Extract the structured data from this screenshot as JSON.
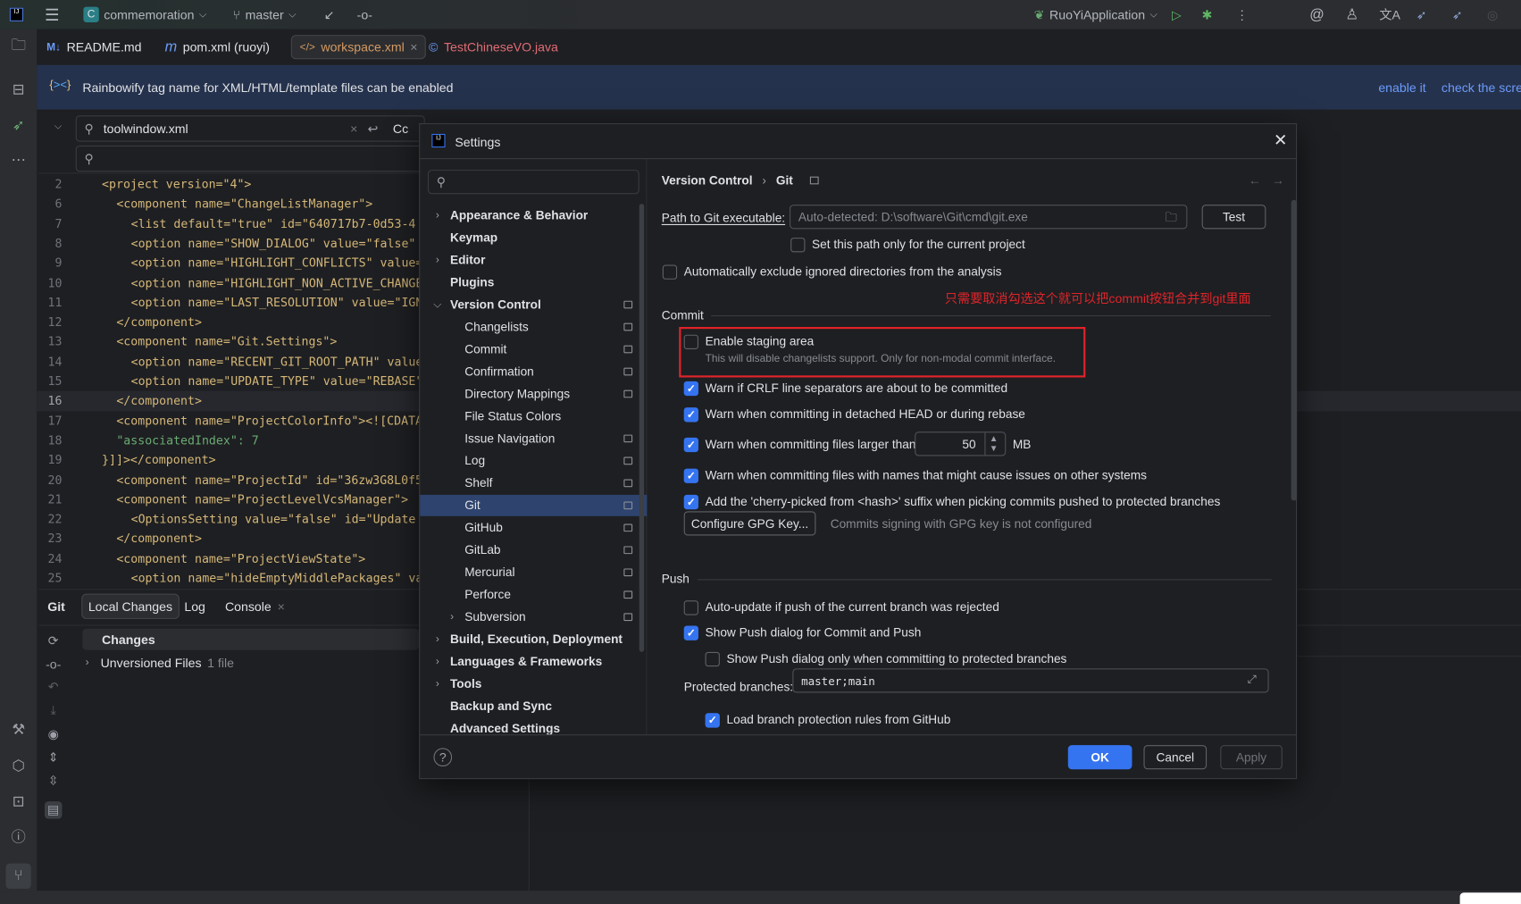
{
  "topbar": {
    "project_badge": "C",
    "project": "commemoration",
    "branch": "master",
    "run_config": "RuoYiApplication"
  },
  "tabs": [
    {
      "icon": "M↓",
      "label": "README.md",
      "color": "#dfe1e5"
    },
    {
      "icon": "m",
      "label": "pom.xml (ruoyi)",
      "color": "#dfe1e5"
    },
    {
      "icon": "</>",
      "label": "workspace.xml",
      "active": true,
      "color": "#d59a63"
    },
    {
      "icon": "©",
      "label": "TestChineseVO.java",
      "color": "#e06c75"
    }
  ],
  "banner": {
    "text": "Rainbowify tag name for XML/HTML/template files can be enabled",
    "enable_link": "enable it",
    "screenshot_link": "check the scree"
  },
  "editor_search": {
    "query": "toolwindow.xml",
    "case_label": "Cc"
  },
  "code": {
    "current_line": 16,
    "lines": [
      {
        "n": 2,
        "indent": 0,
        "text": "<project version=\"4\">"
      },
      {
        "n": 6,
        "indent": 1,
        "text": "<component name=\"ChangeListManager\">"
      },
      {
        "n": 7,
        "indent": 2,
        "text": "<list default=\"true\" id=\"640717b7-0d53-4"
      },
      {
        "n": 8,
        "indent": 2,
        "text": "<option name=\"SHOW_DIALOG\" value=\"false\""
      },
      {
        "n": 9,
        "indent": 2,
        "text": "<option name=\"HIGHLIGHT_CONFLICTS\" value="
      },
      {
        "n": 10,
        "indent": 2,
        "text": "<option name=\"HIGHLIGHT_NON_ACTIVE_CHANGE"
      },
      {
        "n": 11,
        "indent": 2,
        "text": "<option name=\"LAST_RESOLUTION\" value=\"IGN"
      },
      {
        "n": 12,
        "indent": 1,
        "text": "</component>"
      },
      {
        "n": 13,
        "indent": 1,
        "text": "<component name=\"Git.Settings\">"
      },
      {
        "n": 14,
        "indent": 2,
        "text": "<option name=\"RECENT_GIT_ROOT_PATH\" value"
      },
      {
        "n": 15,
        "indent": 2,
        "text": "<option name=\"UPDATE_TYPE\" value=\"REBASE\""
      },
      {
        "n": 16,
        "indent": 1,
        "text": "</component>"
      },
      {
        "n": 17,
        "indent": 1,
        "text": "<component name=\"ProjectColorInfo\"><![CDATA[{"
      },
      {
        "n": 18,
        "indent": 1,
        "text": "\"associatedIndex\": 7"
      },
      {
        "n": 19,
        "indent": 0,
        "text": "}]]></component>"
      },
      {
        "n": 20,
        "indent": 1,
        "text": "<component name=\"ProjectId\" id=\"36zw3G8L0f5"
      },
      {
        "n": 21,
        "indent": 1,
        "text": "<component name=\"ProjectLevelVcsManager\">"
      },
      {
        "n": 22,
        "indent": 2,
        "text": "<OptionsSetting value=\"false\" id=\"Update"
      },
      {
        "n": 23,
        "indent": 1,
        "text": "</component>"
      },
      {
        "n": 24,
        "indent": 1,
        "text": "<component name=\"ProjectViewState\">"
      },
      {
        "n": 25,
        "indent": 2,
        "text": "<option name=\"hideEmptyMiddlePackages\" va"
      }
    ]
  },
  "git_window": {
    "title": "Git",
    "tabs": [
      "Local Changes",
      "Log",
      "Console"
    ],
    "changes_label": "Changes",
    "unversioned_label": "Unversioned Files",
    "unversioned_count": "1 file"
  },
  "settings": {
    "title": "Settings",
    "search_placeholder": "",
    "tree": [
      {
        "label": "Appearance & Behavior",
        "level": 0,
        "bold": true,
        "expandable": true
      },
      {
        "label": "Keymap",
        "level": 0,
        "bold": true
      },
      {
        "label": "Editor",
        "level": 0,
        "bold": true,
        "expandable": true
      },
      {
        "label": "Plugins",
        "level": 0,
        "bold": true
      },
      {
        "label": "Version Control",
        "level": 0,
        "bold": true,
        "expanded": true,
        "project": true
      },
      {
        "label": "Changelists",
        "level": 1,
        "project": true
      },
      {
        "label": "Commit",
        "level": 1,
        "project": true
      },
      {
        "label": "Confirmation",
        "level": 1,
        "project": true
      },
      {
        "label": "Directory Mappings",
        "level": 1,
        "project": true
      },
      {
        "label": "File Status Colors",
        "level": 1
      },
      {
        "label": "Issue Navigation",
        "level": 1,
        "project": true
      },
      {
        "label": "Log",
        "level": 1,
        "project": true
      },
      {
        "label": "Shelf",
        "level": 1,
        "project": true
      },
      {
        "label": "Git",
        "level": 1,
        "project": true,
        "selected": true
      },
      {
        "label": "GitHub",
        "level": 1,
        "project": true
      },
      {
        "label": "GitLab",
        "level": 1,
        "project": true
      },
      {
        "label": "Mercurial",
        "level": 1,
        "project": true
      },
      {
        "label": "Perforce",
        "level": 1,
        "project": true
      },
      {
        "label": "Subversion",
        "level": 1,
        "project": true,
        "expandable": true
      },
      {
        "label": "Build, Execution, Deployment",
        "level": 0,
        "bold": true,
        "expandable": true
      },
      {
        "label": "Languages & Frameworks",
        "level": 0,
        "bold": true,
        "expandable": true
      },
      {
        "label": "Tools",
        "level": 0,
        "bold": true,
        "expandable": true
      },
      {
        "label": "Backup and Sync",
        "level": 0,
        "bold": true
      },
      {
        "label": "Advanced Settings",
        "level": 0,
        "bold": true
      }
    ],
    "breadcrumb": [
      "Version Control",
      "Git"
    ],
    "path_label": "Path to Git executable:",
    "path_placeholder": "Auto-detected: D:\\software\\Git\\cmd\\git.exe",
    "test_button": "Test",
    "path_project_only": {
      "label": "Set this path only for the current project",
      "checked": false
    },
    "auto_exclude": {
      "label": "Automatically exclude ignored directories from the analysis",
      "checked": false
    },
    "annotation": "只需要取消勾选这个就可以把commit按钮合并到git里面",
    "annotation_color": "#e0242a",
    "commit_section": "Commit",
    "staging": {
      "label": "Enable staging area",
      "checked": false,
      "hint": "This will disable changelists support. Only for non-modal commit interface."
    },
    "commit_options": [
      {
        "label": "Warn if CRLF line separators are about to be committed",
        "checked": true
      },
      {
        "label": "Warn when committing in detached HEAD or during rebase",
        "checked": true
      },
      {
        "label": "Warn when committing files larger than",
        "checked": true
      },
      {
        "label": "Warn when committing files with names that might cause issues on other systems",
        "checked": true
      },
      {
        "label": "Add the 'cherry-picked from <hash>' suffix when picking commits pushed to protected branches",
        "checked": true
      }
    ],
    "size_limit": "50",
    "size_unit": "MB",
    "gpg_button": "Configure GPG Key...",
    "gpg_status": "Commits signing with GPG key is not configured",
    "push_section": "Push",
    "push_options": [
      {
        "label": "Auto-update if push of the current branch was rejected",
        "checked": false
      },
      {
        "label": "Show Push dialog for Commit and Push",
        "checked": true
      },
      {
        "label": "Show Push dialog only when committing to protected branches",
        "checked": false
      }
    ],
    "protected_label": "Protected branches:",
    "protected_value": "master;main",
    "load_rules": {
      "label": "Load branch protection rules from GitHub",
      "checked": true
    },
    "ok": "OK",
    "cancel": "Cancel",
    "apply": "Apply"
  },
  "colors": {
    "accent": "#3574f0",
    "selection": "#2e436e",
    "banner": "#25324d",
    "highlight_box": "#e0242a"
  }
}
